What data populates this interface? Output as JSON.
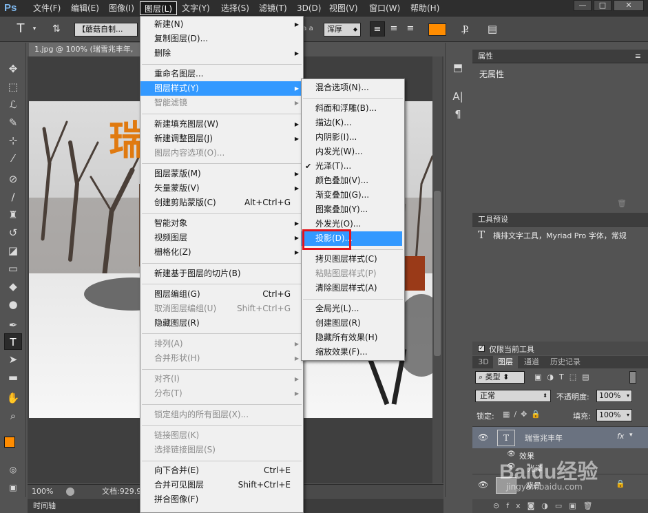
{
  "app": {
    "logo": "Ps"
  },
  "menubar": {
    "items": [
      "文件(F)",
      "编辑(E)",
      "图像(I)",
      "图层(L)",
      "文字(Y)",
      "选择(S)",
      "滤镜(T)",
      "3D(D)",
      "视图(V)",
      "窗口(W)",
      "帮助(H)"
    ],
    "active_index": 3
  },
  "window_controls": {
    "minimize": "—",
    "restore": "□",
    "close": "✕"
  },
  "options_bar": {
    "font_name": "【蘑菇自制...",
    "aa_label": "a a",
    "aa_mode": "浑厚",
    "color_swatch": "#ff8c00"
  },
  "document": {
    "tab_title": "1.jpg @ 100% (瑞雪兆丰年,",
    "zoom": "100%",
    "doc_info": "文档:929.9",
    "overlay_text": "瑞",
    "overlay_color": "#e07a10"
  },
  "timeline_label": "时间轴",
  "layer_menu": {
    "items": [
      {
        "label": "新建(N)",
        "submenu": true
      },
      {
        "label": "复制图层(D)...",
        "submenu": false
      },
      {
        "label": "删除",
        "submenu": true
      },
      {
        "sep": true
      },
      {
        "label": "重命名图层...",
        "submenu": false
      },
      {
        "label": "图层样式(Y)",
        "submenu": true,
        "highlighted": true
      },
      {
        "label": "智能滤镜",
        "submenu": true,
        "disabled": true
      },
      {
        "sep": true
      },
      {
        "label": "新建填充图层(W)",
        "submenu": true
      },
      {
        "label": "新建调整图层(J)",
        "submenu": true
      },
      {
        "label": "图层内容选项(O)...",
        "disabled": true
      },
      {
        "sep": true
      },
      {
        "label": "图层蒙版(M)",
        "submenu": true
      },
      {
        "label": "矢量蒙版(V)",
        "submenu": true
      },
      {
        "label": "创建剪贴蒙版(C)",
        "shortcut": "Alt+Ctrl+G"
      },
      {
        "sep": true
      },
      {
        "label": "智能对象",
        "submenu": true
      },
      {
        "label": "视频图层",
        "submenu": true
      },
      {
        "label": "栅格化(Z)",
        "submenu": true
      },
      {
        "sep": true
      },
      {
        "label": "新建基于图层的切片(B)"
      },
      {
        "sep": true
      },
      {
        "label": "图层编组(G)",
        "shortcut": "Ctrl+G"
      },
      {
        "label": "取消图层编组(U)",
        "shortcut": "Shift+Ctrl+G",
        "disabled": true
      },
      {
        "label": "隐藏图层(R)"
      },
      {
        "sep": true
      },
      {
        "label": "排列(A)",
        "submenu": true,
        "disabled": true
      },
      {
        "label": "合并形状(H)",
        "submenu": true,
        "disabled": true
      },
      {
        "sep": true
      },
      {
        "label": "对齐(I)",
        "submenu": true,
        "disabled": true
      },
      {
        "label": "分布(T)",
        "submenu": true,
        "disabled": true
      },
      {
        "sep": true
      },
      {
        "label": "锁定组内的所有图层(X)...",
        "disabled": true
      },
      {
        "sep": true
      },
      {
        "label": "链接图层(K)",
        "disabled": true
      },
      {
        "label": "选择链接图层(S)",
        "disabled": true
      },
      {
        "sep": true
      },
      {
        "label": "向下合并(E)",
        "shortcut": "Ctrl+E"
      },
      {
        "label": "合并可见图层",
        "shortcut": "Shift+Ctrl+E"
      },
      {
        "label": "拼合图像(F)"
      }
    ]
  },
  "style_submenu": {
    "items": [
      {
        "label": "混合选项(N)..."
      },
      {
        "sep": true
      },
      {
        "label": "斜面和浮雕(B)..."
      },
      {
        "label": "描边(K)..."
      },
      {
        "label": "内阴影(I)..."
      },
      {
        "label": "内发光(W)..."
      },
      {
        "label": "光泽(T)...",
        "checked": true
      },
      {
        "label": "颜色叠加(V)..."
      },
      {
        "label": "渐变叠加(G)..."
      },
      {
        "label": "图案叠加(Y)..."
      },
      {
        "label": "外发光(O)..."
      },
      {
        "label": "投影(D)...",
        "highlighted": true,
        "boxed": true
      },
      {
        "sep": true
      },
      {
        "label": "拷贝图层样式(C)"
      },
      {
        "label": "粘贴图层样式(P)",
        "disabled": true
      },
      {
        "label": "清除图层样式(A)"
      },
      {
        "sep": true
      },
      {
        "label": "全局光(L)..."
      },
      {
        "label": "创建图层(R)"
      },
      {
        "label": "隐藏所有效果(H)"
      },
      {
        "label": "缩放效果(F)..."
      }
    ],
    "check_mark": "✔",
    "box_color": "#e3131b"
  },
  "properties_panel": {
    "title": "属性",
    "content": "无属性"
  },
  "tool_presets_panel": {
    "title": "工具预设",
    "item": "横排文字工具，Myriad Pro 字体，常规",
    "checkbox_label": "仅限当前工具"
  },
  "layers_panel": {
    "tabs": [
      "3D",
      "图层",
      "通道",
      "历史记录"
    ],
    "active_tab": 1,
    "filter_label": "类型",
    "blend_mode": "正常",
    "opacity_label": "不透明度:",
    "opacity_value": "100%",
    "lock_label": "锁定:",
    "fill_label": "填充:",
    "fill_value": "100%",
    "layers": [
      {
        "name": "瑞雪兆丰年",
        "type": "text",
        "fx": "fx",
        "selected": true
      },
      {
        "name": "效果",
        "type": "effects"
      },
      {
        "name": "光泽",
        "type": "effect"
      },
      {
        "name": "背景",
        "type": "image"
      }
    ]
  },
  "watermark": {
    "text": "Baidu经验",
    "url": "jingyan.baidu.com"
  }
}
